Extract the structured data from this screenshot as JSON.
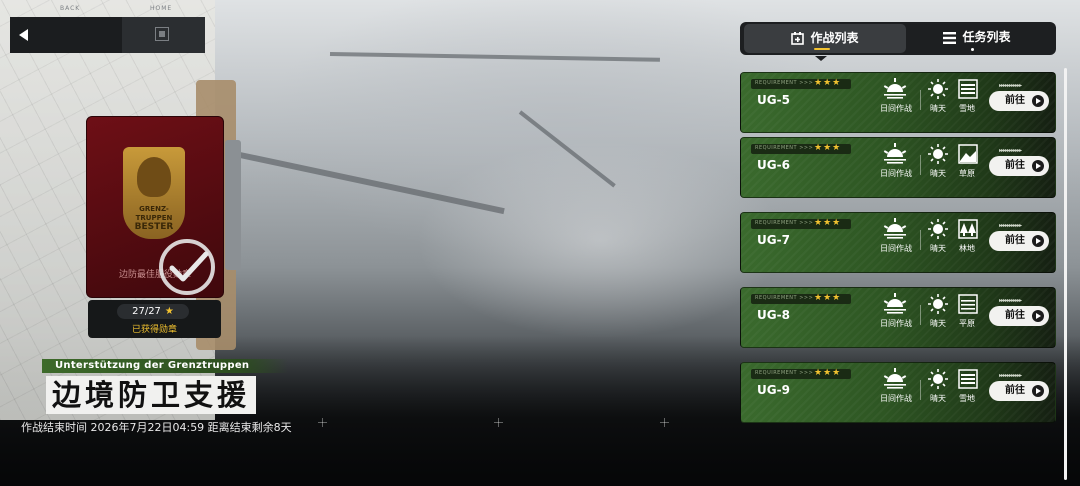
{
  "topbar": {
    "back_label": "BACK",
    "home_label": "HOME"
  },
  "medal": {
    "badge_text_1": "GRENZ-",
    "badge_text_2": "TRUPPEN",
    "badge_text_3": "BESTER",
    "name": "边防最佳服役勋章",
    "count": "27/27",
    "star": "★",
    "status": "已获得勋章"
  },
  "event": {
    "subtitle": "Unterstützung der Grenztruppen",
    "title": "边境防卫支援",
    "meta": "作战结束时间 2026年7月22日04:59 距离结束剩余8天"
  },
  "tabs": [
    {
      "label": "作战列表",
      "active": true
    },
    {
      "label": "任务列表",
      "active": false
    }
  ],
  "missions": [
    {
      "requirement": "REQUIREMENT >>>",
      "stars": "★★★",
      "code": "UG-5",
      "op": "日间作战",
      "weather": "晴天",
      "terrain": "雪地",
      "terrain_icon": "snowfield-icon",
      "go": "前往",
      "arrows": "▸▸▸▸▸▸▸▸▸▸▸"
    },
    {
      "requirement": "REQUIREMENT >>>",
      "stars": "★★★",
      "code": "UG-6",
      "op": "日间作战",
      "weather": "晴天",
      "terrain": "草原",
      "terrain_icon": "grassland-icon",
      "go": "前往",
      "arrows": "▸▸▸▸▸▸▸▸▸▸▸"
    },
    {
      "requirement": "REQUIREMENT >>>",
      "stars": "★★★",
      "code": "UG-7",
      "op": "日间作战",
      "weather": "晴天",
      "terrain": "林地",
      "terrain_icon": "forest-icon",
      "go": "前往",
      "arrows": "▸▸▸▸▸▸▸▸▸▸▸"
    },
    {
      "requirement": "REQUIREMENT >>>",
      "stars": "★★★",
      "code": "UG-8",
      "op": "日间作战",
      "weather": "晴天",
      "terrain": "平原",
      "terrain_icon": "plain-icon",
      "go": "前往",
      "arrows": "▸▸▸▸▸▸▸▸▸▸▸"
    },
    {
      "requirement": "REQUIREMENT >>>",
      "stars": "★★★",
      "code": "UG-9",
      "op": "日间作战",
      "weather": "晴天",
      "terrain": "雪地",
      "terrain_icon": "snowfield-icon",
      "go": "前往",
      "arrows": "▸▸▸▸▸▸▸▸▸▸▸"
    }
  ],
  "colors": {
    "accent": "#f2c230",
    "card_green": "#2e5623",
    "medal_red": "#6e0f16"
  }
}
